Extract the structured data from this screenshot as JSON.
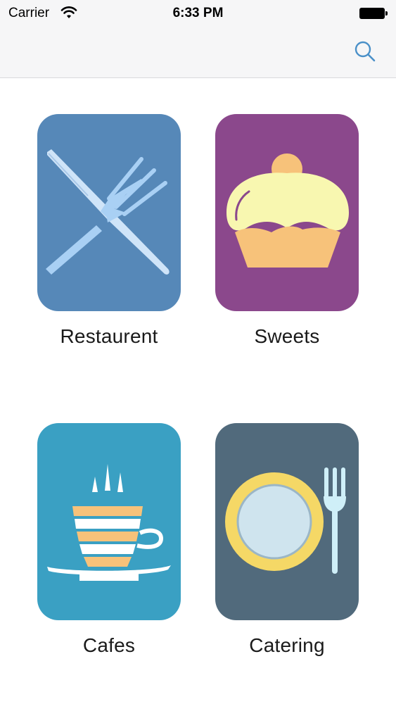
{
  "status_bar": {
    "carrier": "Carrier",
    "time": "6:33 PM",
    "wifi_icon": "wifi-icon",
    "battery_icon": "battery-icon"
  },
  "nav_bar": {
    "search_icon": "search-icon",
    "accent_color": "#4a90c8"
  },
  "categories": [
    {
      "label": "Restaurent",
      "icon": "knife-fork-icon",
      "color": "#5688b8"
    },
    {
      "label": "Sweets",
      "icon": "cupcake-icon",
      "color": "#8b488c"
    },
    {
      "label": "Cafes",
      "icon": "coffee-cup-icon",
      "color": "#3aa0c3"
    },
    {
      "label": "Catering",
      "icon": "plate-fork-icon",
      "color": "#516a7c"
    }
  ]
}
